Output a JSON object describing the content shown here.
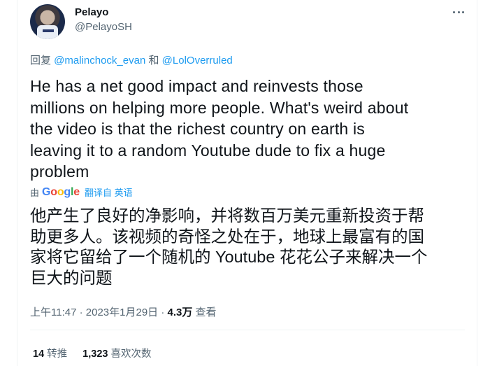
{
  "author": {
    "name": "Pelayo",
    "handle": "@PelayoSH",
    "avatar_icon": "user-avatar-icon"
  },
  "reply": {
    "prefix": "回复 ",
    "user1": "@malinchock_evan",
    "joiner": " 和 ",
    "user2": "@LolOverruled"
  },
  "tweet": {
    "text_en": "He has a net good impact and reinvests those\nmillions on helping more people. What's weird about\nthe video is that the richest country on earth is\nleaving it to a random Youtube dude to fix a huge\nproblem",
    "translated_by": "由",
    "translate_label": "翻译自 英语",
    "text_zh": "他产生了良好的净影响，并将数百万美元重新投资于帮\n助更多人。该视频的奇怪之处在于，地球上最富有的国\n家将它留给了一个随机的 Youtube 花花公子来解决一个\n巨大的问题"
  },
  "meta": {
    "time": "上午11:47",
    "sep1": " · ",
    "date": "2023年1月29日",
    "sep2": " · ",
    "views_count": "4.3万",
    "views_label": " 查看"
  },
  "stats": {
    "retweets_count": "14",
    "retweets_label": "转推",
    "likes_count": "1,323",
    "likes_label": "喜欢次数"
  },
  "colors": {
    "link": "#1d9bf0",
    "secondary_text": "#536471",
    "primary_text": "#0f1419"
  }
}
